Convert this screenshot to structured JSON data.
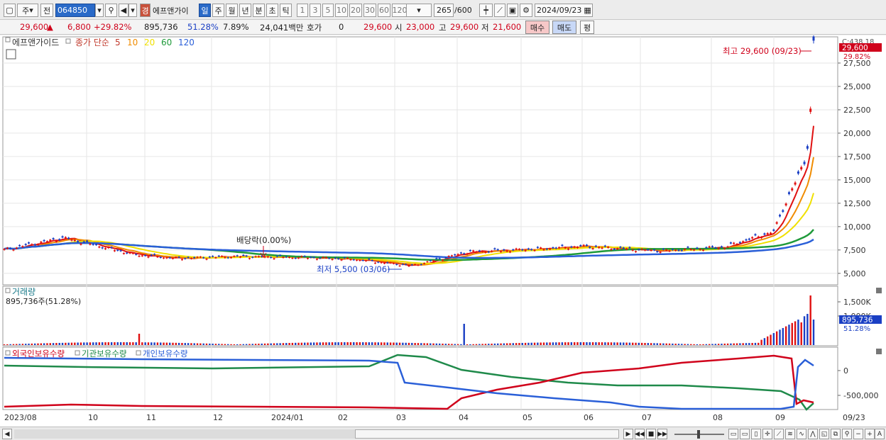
{
  "toolbar": {
    "market_label": "주",
    "prev_label": "전",
    "code": "064850",
    "stock_name": "에프앤가이",
    "name_badge": "경",
    "periods": [
      "일",
      "주",
      "월",
      "년",
      "분",
      "초",
      "틱"
    ],
    "selected_period": "일",
    "intervals": [
      "1",
      "3",
      "5",
      "10",
      "20",
      "30",
      "60",
      "120"
    ],
    "count_display": "265",
    "count_total": "/600",
    "date": "2024/09/23"
  },
  "quote": {
    "price": "29,600",
    "change": "6,800",
    "change_pct": "+29.82%",
    "volume": "895,736",
    "vol_ratio": "51.28%",
    "turnover": "7.89%",
    "amount": "24,041백만",
    "hoga_label": "호가",
    "hoga_value": "0",
    "hoga_price": "29,600",
    "open_label": "시",
    "open": "23,000",
    "high_label": "고",
    "high": "29,600",
    "low_label": "저",
    "low": "21,600",
    "buy_label": "매수",
    "sell_label": "매도",
    "eval_label": "평"
  },
  "price_panel": {
    "legend_stock": "에프앤가이드",
    "legend_ma_label": "종가 단순",
    "ma_periods": [
      "5",
      "10",
      "20",
      "60",
      "120"
    ],
    "ma_colors": [
      "#e01010",
      "#f08c00",
      "#f0e000",
      "#1f9a3a",
      "#2a5fd8"
    ],
    "y_ticks": [
      "27,500",
      "25,000",
      "22,500",
      "20,000",
      "17,500",
      "15,000",
      "12,500",
      "10,000",
      "7,500",
      "5,000"
    ],
    "c_value": "C:438.18",
    "price_badge": "29,600",
    "pct_badge": "29.82%",
    "annotation_high": "최고 29,600 (09/23)",
    "annotation_low": "최저 5,500 (03/06)",
    "annotation_dividend": "배당락(0.00%)"
  },
  "volume_panel": {
    "title": "거래량",
    "value_label": "895,736주(51.28%)",
    "y_ticks": [
      "1,500K",
      "1,000K"
    ],
    "value_badge": "895,736",
    "pct_badge": "51.28%"
  },
  "holding_panel": {
    "legend": [
      "외국인보유수량",
      "기관보유수량",
      "개인보유수량"
    ],
    "legend_colors": [
      "#d0021b",
      "#1f8a4a",
      "#2a5fd8"
    ],
    "y_ticks": [
      "0",
      "-500,000"
    ]
  },
  "x_axis": {
    "labels": [
      "2023/08",
      "10",
      "11",
      "12",
      "2024/01",
      "02",
      "03",
      "04",
      "05",
      "06",
      "07",
      "08",
      "09"
    ],
    "right_label": "09/23"
  },
  "chart_data": {
    "type": "line",
    "title": "에프앤가이드",
    "price_series": {
      "name": "종가",
      "x": [
        "2023/08",
        "2023/09",
        "2023/10",
        "2023/11",
        "2023/12",
        "2024/01",
        "2024/02",
        "2024/03",
        "2024/04",
        "2024/05",
        "2024/06",
        "2024/07",
        "2024/08",
        "2024/09",
        "2024/09/10",
        "2024/09/13",
        "2024/09/19",
        "2024/09/20",
        "2024/09/23"
      ],
      "values": [
        7500,
        8800,
        7000,
        6600,
        6800,
        6700,
        6500,
        5800,
        7300,
        7600,
        7900,
        7400,
        7800,
        9500,
        13500,
        15000,
        17500,
        22800,
        29600
      ]
    },
    "ylim": [
      4000,
      30000
    ]
  }
}
